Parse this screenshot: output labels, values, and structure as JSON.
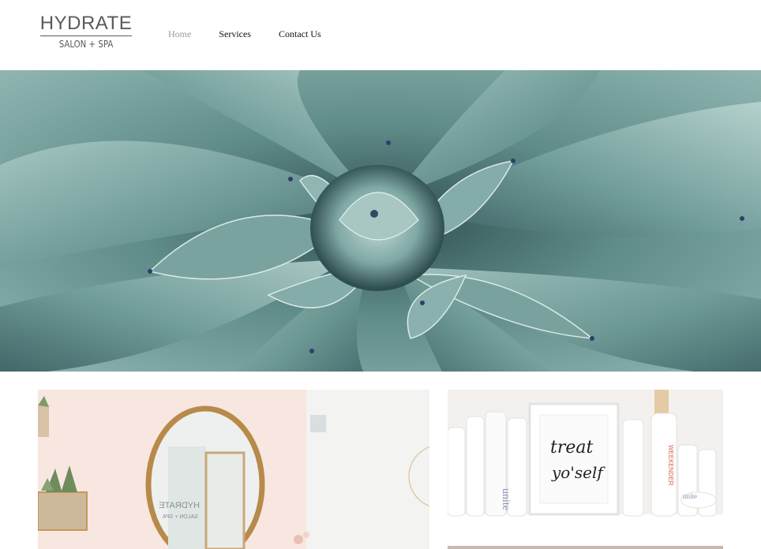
{
  "logo": {
    "title": "HYDRATE",
    "subtitle": "SALON + SPA"
  },
  "nav": {
    "items": [
      {
        "label": "Home",
        "active": true
      },
      {
        "label": "Services",
        "active": false
      },
      {
        "label": "Contact Us",
        "active": false
      }
    ]
  },
  "hero": {
    "image": "agave-succulent-photo",
    "dominant_color": "#6f9894"
  },
  "gallery": {
    "left": {
      "image": "salon-mirror-interior-photo",
      "mirror_text": [
        "HYDRATE",
        "SALON + SPA"
      ]
    },
    "right": {
      "image": "hair-product-shelf-photo",
      "sign_text": [
        "treat",
        "yo'self"
      ],
      "bottle_labels": [
        "unite",
        "WEEKENDER",
        "unite"
      ]
    }
  },
  "colors": {
    "nav_active": "#9a9a9a",
    "nav_text": "#111111",
    "logo": "#5a5a5a"
  }
}
